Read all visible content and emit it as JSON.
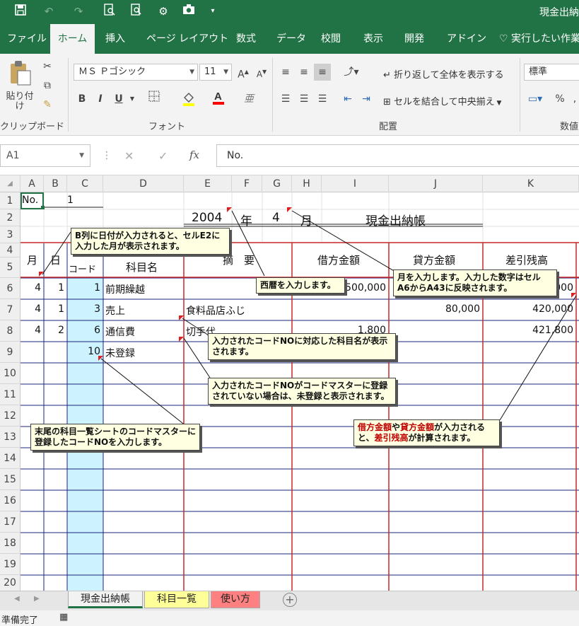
{
  "app": {
    "title": "現金出納"
  },
  "qat": {
    "save_icon": "save-icon",
    "undo_icon": "undo-icon",
    "redo_icon": "redo-icon",
    "preview_icon": "print-preview-icon",
    "camera_icon": "camera-icon"
  },
  "tabs": [
    {
      "label": "ファイル"
    },
    {
      "label": "ホーム"
    },
    {
      "label": "挿入"
    },
    {
      "label": "ページ レイアウト"
    },
    {
      "label": "数式"
    },
    {
      "label": "データ"
    },
    {
      "label": "校閲"
    },
    {
      "label": "表示"
    },
    {
      "label": "開発"
    },
    {
      "label": "アドイン"
    },
    {
      "label": "実行したい作業"
    }
  ],
  "ribbon": {
    "clipboard": {
      "paste_label": "貼り付け",
      "group": "クリップボード"
    },
    "font": {
      "name": "ＭＳ Ｐゴシック",
      "size": "11",
      "bold": "B",
      "italic": "I",
      "underline": "U",
      "group": "フォント"
    },
    "align": {
      "wrap": "折り返して全体を表示する",
      "merge": "セルを結合して中央揃え",
      "group": "配置"
    },
    "number": {
      "format": "標準",
      "percent": "%",
      "group": "数値"
    }
  },
  "formula": {
    "namebox": "A1",
    "cancel": "✕",
    "enter": "✓",
    "fx": "fx",
    "content": "No."
  },
  "columns": [
    "A",
    "B",
    "C",
    "D",
    "E",
    "F",
    "G",
    "H",
    "I",
    "J",
    "K"
  ],
  "rows": [
    "1",
    "2",
    "3",
    "4",
    "5",
    "6",
    "7",
    "8",
    "9",
    "10",
    "11",
    "12",
    "13",
    "14",
    "15",
    "16",
    "17",
    "18",
    "19",
    "20"
  ],
  "sheet": {
    "a1": "No.",
    "b1": "1",
    "year": "2004",
    "year_lbl": "年",
    "month": "4",
    "month_lbl": "月",
    "title": "現金出納帳",
    "h_month": "月",
    "h_day": "日",
    "h_code": "コード",
    "h_subject": "科目名",
    "h_desc": "摘　要",
    "h_debit": "借方金額",
    "h_credit": "貸方金額",
    "h_balance": "差引残高",
    "r6": {
      "m": "4",
      "d": "1",
      "code": "1",
      "subject": "前期繰越",
      "desc": "",
      "debit": "500,000",
      "credit": "",
      "balance": "500,000"
    },
    "r7": {
      "m": "4",
      "d": "1",
      "code": "3",
      "subject": "売上",
      "desc": "食料品店ふじ",
      "debit": "",
      "credit": "80,000",
      "balance": "420,000"
    },
    "r8": {
      "m": "4",
      "d": "2",
      "code": "6",
      "subject": "通信費",
      "desc": "切手代",
      "debit": "1,800",
      "credit": "",
      "balance": "421,800"
    },
    "r9": {
      "code": "10",
      "subject": "未登録"
    }
  },
  "notes": {
    "n1": "B列に日付が入力されると、セルE2に入力した月が表示されます。",
    "n2": "西暦を入力します。",
    "n3": "月を入力します。入力した数字はセルA6からA43に反映されます。",
    "n4": "入力されたコードNOに対応した科目名が表示されます。",
    "n5": "入力されたコードNOがコードマスターに登録されていない場合は、未登録と表示されます。",
    "n6": "末尾の科目一覧シートのコードマスターに登録したコードNOを入力します。",
    "n7a": "借方金額",
    "n7b": "や",
    "n7c": "貸方金額",
    "n7d": "が入力されると、",
    "n7e": "差引残高",
    "n7f": "が計算されます。"
  },
  "sheet_tabs": [
    {
      "label": "現金出納帳",
      "color": "#f2f2f2"
    },
    {
      "label": "科目一覧",
      "color": "#ffff99"
    },
    {
      "label": "使い方",
      "color": "#ff8080"
    }
  ],
  "status": {
    "text": "準備完了"
  }
}
